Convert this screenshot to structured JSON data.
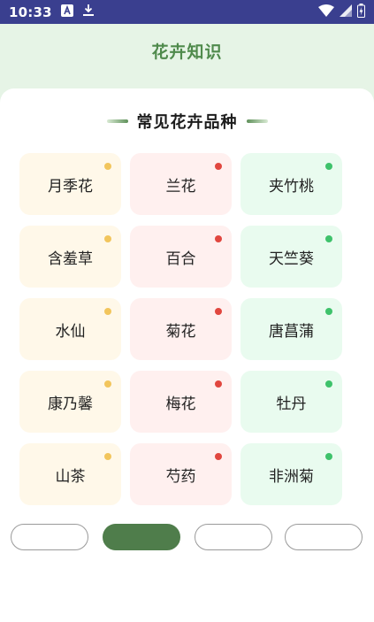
{
  "status_bar": {
    "time": "10:33",
    "left_icons": [
      "notification-a-icon",
      "download-icon"
    ],
    "right_icons": [
      "wifi-icon",
      "signal-icon",
      "battery-icon"
    ]
  },
  "header": {
    "title": "花卉知识"
  },
  "section": {
    "title": "常见花卉品种"
  },
  "flowers": [
    {
      "name": "月季花",
      "theme": "yellow",
      "dot_color": "#f2c55c"
    },
    {
      "name": "兰花",
      "theme": "red",
      "dot_color": "#e1473f"
    },
    {
      "name": "夹竹桃",
      "theme": "green",
      "dot_color": "#3ec26b"
    },
    {
      "name": "含羞草",
      "theme": "yellow",
      "dot_color": "#f2c55c"
    },
    {
      "name": "百合",
      "theme": "red",
      "dot_color": "#e1473f"
    },
    {
      "name": "天竺葵",
      "theme": "green",
      "dot_color": "#3ec26b"
    },
    {
      "name": "水仙",
      "theme": "yellow",
      "dot_color": "#f2c55c"
    },
    {
      "name": "菊花",
      "theme": "red",
      "dot_color": "#e1473f"
    },
    {
      "name": "唐菖蒲",
      "theme": "green",
      "dot_color": "#3ec26b"
    },
    {
      "name": "康乃馨",
      "theme": "yellow",
      "dot_color": "#f2c55c"
    },
    {
      "name": "梅花",
      "theme": "red",
      "dot_color": "#e1473f"
    },
    {
      "name": "牡丹",
      "theme": "green",
      "dot_color": "#3ec26b"
    },
    {
      "name": "山茶",
      "theme": "yellow",
      "dot_color": "#f2c55c"
    },
    {
      "name": "芍药",
      "theme": "red",
      "dot_color": "#e1473f"
    },
    {
      "name": "非洲菊",
      "theme": "green",
      "dot_color": "#3ec26b"
    }
  ],
  "bottom_tabs": {
    "count": 4,
    "active_index": 1
  },
  "colors": {
    "status_bar": "#3a3f8f",
    "header_bg": "#e6f4e6",
    "title_green": "#4f8a4c",
    "active_tab": "#4f7d4b"
  }
}
